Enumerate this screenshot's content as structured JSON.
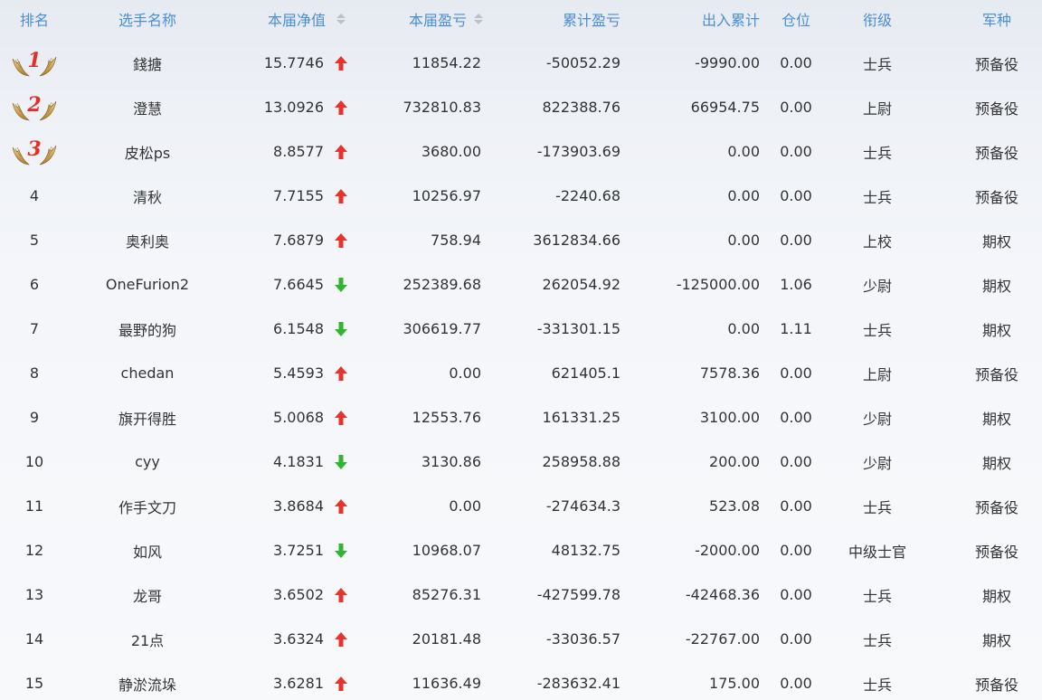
{
  "headers": {
    "rank": "排名",
    "name": "选手名称",
    "nav": "本届净值",
    "pnl": "本届盈亏",
    "cum_pnl": "累计盈亏",
    "flow": "出入累计",
    "position": "仓位",
    "grade": "衔级",
    "branch": "军种"
  },
  "colors": {
    "header_text": "#4a8fd6",
    "up_arrow": "#e8332d",
    "down_arrow": "#2fb52f",
    "medal_gold": "#c9a24a",
    "rank_number": "#e0302a"
  },
  "rows": [
    {
      "rank": "1",
      "medal": true,
      "name": "錢搪",
      "nav": "15.7746",
      "trend": "up",
      "pnl": "11854.22",
      "cum": "-50052.29",
      "flow": "-9990.00",
      "pos": "0.00",
      "grade": "士兵",
      "branch": "预备役"
    },
    {
      "rank": "2",
      "medal": true,
      "name": "澄慧",
      "nav": "13.0926",
      "trend": "up",
      "pnl": "732810.83",
      "cum": "822388.76",
      "flow": "66954.75",
      "pos": "0.00",
      "grade": "上尉",
      "branch": "预备役"
    },
    {
      "rank": "3",
      "medal": true,
      "name": "皮松ps",
      "nav": "8.8577",
      "trend": "up",
      "pnl": "3680.00",
      "cum": "-173903.69",
      "flow": "0.00",
      "pos": "0.00",
      "grade": "士兵",
      "branch": "预备役"
    },
    {
      "rank": "4",
      "medal": false,
      "name": "清秋",
      "nav": "7.7155",
      "trend": "up",
      "pnl": "10256.97",
      "cum": "-2240.68",
      "flow": "0.00",
      "pos": "0.00",
      "grade": "士兵",
      "branch": "预备役"
    },
    {
      "rank": "5",
      "medal": false,
      "name": "奥利奥",
      "nav": "7.6879",
      "trend": "up",
      "pnl": "758.94",
      "cum": "3612834.66",
      "flow": "0.00",
      "pos": "0.00",
      "grade": "上校",
      "branch": "期权"
    },
    {
      "rank": "6",
      "medal": false,
      "name": "OneFurion2",
      "nav": "7.6645",
      "trend": "down",
      "pnl": "252389.68",
      "cum": "262054.92",
      "flow": "-125000.00",
      "pos": "1.06",
      "grade": "少尉",
      "branch": "期权"
    },
    {
      "rank": "7",
      "medal": false,
      "name": "最野的狗",
      "nav": "6.1548",
      "trend": "down",
      "pnl": "306619.77",
      "cum": "-331301.15",
      "flow": "0.00",
      "pos": "1.11",
      "grade": "士兵",
      "branch": "期权"
    },
    {
      "rank": "8",
      "medal": false,
      "name": "chedan",
      "nav": "5.4593",
      "trend": "up",
      "pnl": "0.00",
      "cum": "621405.1",
      "flow": "7578.36",
      "pos": "0.00",
      "grade": "上尉",
      "branch": "预备役"
    },
    {
      "rank": "9",
      "medal": false,
      "name": "旗开得胜",
      "nav": "5.0068",
      "trend": "up",
      "pnl": "12553.76",
      "cum": "161331.25",
      "flow": "3100.00",
      "pos": "0.00",
      "grade": "少尉",
      "branch": "期权"
    },
    {
      "rank": "10",
      "medal": false,
      "name": "cyy",
      "nav": "4.1831",
      "trend": "down",
      "pnl": "3130.86",
      "cum": "258958.88",
      "flow": "200.00",
      "pos": "0.00",
      "grade": "少尉",
      "branch": "期权"
    },
    {
      "rank": "11",
      "medal": false,
      "name": "作手文刀",
      "nav": "3.8684",
      "trend": "up",
      "pnl": "0.00",
      "cum": "-274634.3",
      "flow": "523.08",
      "pos": "0.00",
      "grade": "士兵",
      "branch": "预备役"
    },
    {
      "rank": "12",
      "medal": false,
      "name": "如风",
      "nav": "3.7251",
      "trend": "down",
      "pnl": "10968.07",
      "cum": "48132.75",
      "flow": "-2000.00",
      "pos": "0.00",
      "grade": "中级士官",
      "branch": "预备役"
    },
    {
      "rank": "13",
      "medal": false,
      "name": "龙哥",
      "nav": "3.6502",
      "trend": "up",
      "pnl": "85276.31",
      "cum": "-427599.78",
      "flow": "-42468.36",
      "pos": "0.00",
      "grade": "士兵",
      "branch": "期权"
    },
    {
      "rank": "14",
      "medal": false,
      "name": "21点",
      "nav": "3.6324",
      "trend": "up",
      "pnl": "20181.48",
      "cum": "-33036.57",
      "flow": "-22767.00",
      "pos": "0.00",
      "grade": "士兵",
      "branch": "期权"
    },
    {
      "rank": "15",
      "medal": false,
      "name": "静淤流垛",
      "nav": "3.6281",
      "trend": "up",
      "pnl": "11636.49",
      "cum": "-283632.41",
      "flow": "175.00",
      "pos": "0.00",
      "grade": "士兵",
      "branch": "预备役"
    }
  ]
}
